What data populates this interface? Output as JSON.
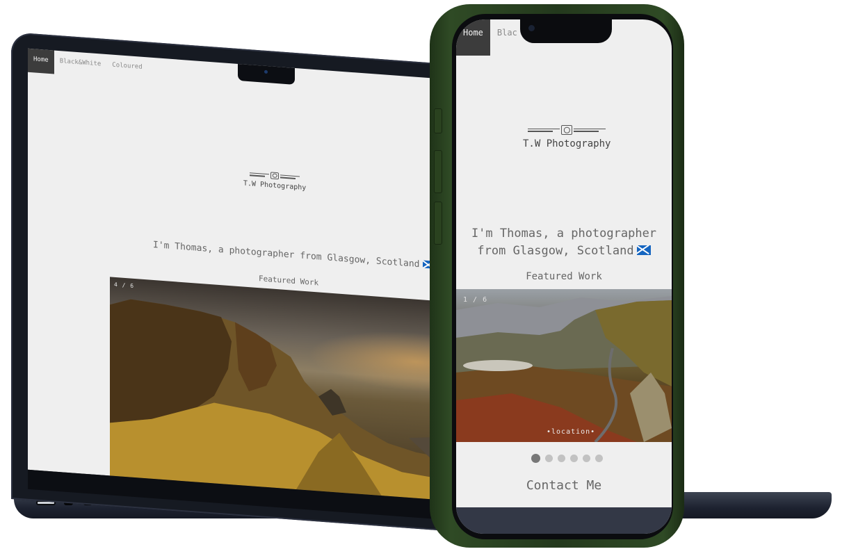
{
  "nav": {
    "tabs": [
      "Home",
      "Black&White",
      "Coloured"
    ],
    "active": "Home",
    "phone_tab_truncated": "Blac"
  },
  "brand": {
    "logo_text": "T.W Photography"
  },
  "intro": {
    "laptop_text": "I'm Thomas, a photographer from Glasgow, Scotland",
    "phone_line1": "I'm Thomas, a photographer",
    "phone_line2": "from Glasgow, Scotland",
    "flag_icon": "scotland-flag-icon"
  },
  "featured": {
    "heading": "Featured Work",
    "laptop_counter": "4 / 6",
    "phone_counter": "1 / 6",
    "phone_caption": "location",
    "slide_count": 6,
    "phone_active_slide": 1
  },
  "contact": {
    "heading": "Contact Me"
  },
  "colors": {
    "page_bg": "#efefef",
    "nav_active_bg": "#3c3c3c",
    "text": "#666666",
    "phone_frame": "#2f4a25",
    "laptop_frame": "#161a22"
  }
}
